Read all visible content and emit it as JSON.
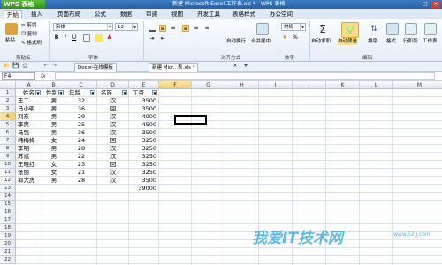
{
  "titlebar": {
    "app_button": "WPS 表格",
    "title": "新建 Microsoft Excel 工作表.xls * - WPS 表格"
  },
  "menu": {
    "tabs": [
      "开始",
      "插入",
      "页面布局",
      "公式",
      "数据",
      "审阅",
      "视图",
      "开发工具",
      "表格样式",
      "办公空间"
    ]
  },
  "ribbon": {
    "paste": "粘贴",
    "cut": "剪切",
    "copy": "复制",
    "format_painter": "格式刷",
    "font_name": "宋体",
    "font_size": "12",
    "merge_center": "合并居中",
    "wrap": "自动换行",
    "general": "常规",
    "autosum": "自动求和",
    "autofilter": "自动筛选",
    "sort": "排序",
    "format": "格式",
    "row_col": "行和列",
    "worksheet": "工作表",
    "groups": {
      "clipboard": "剪贴板",
      "font": "字体",
      "alignment": "对齐方式",
      "number": "数字",
      "edit": "编辑"
    }
  },
  "doc_tabs": [
    "Docer-在线模板",
    "新建 Micr...表.xls *"
  ],
  "formula_bar": {
    "name_box": "F4",
    "fx": "fx",
    "value": ""
  },
  "grid": {
    "columns": [
      "A",
      "B",
      "C",
      "D",
      "E",
      "F",
      "G",
      "H",
      "I",
      "J",
      "K",
      "L",
      "M"
    ],
    "rows": [
      "1",
      "2",
      "3",
      "4",
      "5",
      "6",
      "7",
      "8",
      "9",
      "10",
      "11",
      "12",
      "13",
      "14",
      "15",
      "16",
      "17",
      "18",
      "19",
      "20",
      "21",
      "22"
    ],
    "headers": [
      "姓名",
      "性别",
      "年龄",
      "名族",
      "工资"
    ],
    "data": [
      [
        "王二",
        "男",
        "32",
        "汉",
        "3500"
      ],
      [
        "马小明",
        "男",
        "36",
        "回",
        "3500"
      ],
      [
        "刘东",
        "男",
        "29",
        "汉",
        "4000"
      ],
      [
        "李爽",
        "男",
        "25",
        "汉",
        "4500"
      ],
      [
        "马强",
        "男",
        "36",
        "汉",
        "3500"
      ],
      [
        "韩梅梅",
        "女",
        "24",
        "回",
        "3250"
      ],
      [
        "李明",
        "男",
        "28",
        "汉",
        "3250"
      ],
      [
        "苏斌",
        "男",
        "22",
        "汉",
        "3250"
      ],
      [
        "王晓红",
        "女",
        "23",
        "回",
        "3250"
      ],
      [
        "张丽",
        "女",
        "21",
        "汉",
        "3250"
      ],
      [
        "郭大虎",
        "男",
        "28",
        "汉",
        "3500"
      ]
    ],
    "total": "39000"
  },
  "watermark": {
    "text": "我爱IT技术网",
    "url": "www.52ij.com"
  }
}
